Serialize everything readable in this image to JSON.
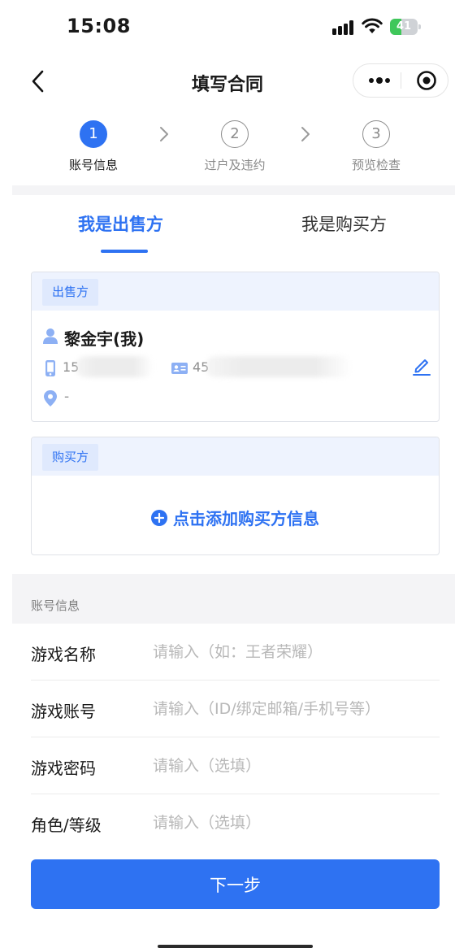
{
  "status_bar": {
    "time": "15:08",
    "battery": "41",
    "battery_level": 0.41
  },
  "nav": {
    "title": "填写合同"
  },
  "steps": [
    {
      "number": "1",
      "label": "账号信息",
      "active": true
    },
    {
      "number": "2",
      "label": "过户及违约",
      "active": false
    },
    {
      "number": "3",
      "label": "预览检查",
      "active": false
    }
  ],
  "role_tabs": {
    "seller": "我是出售方",
    "buyer": "我是购买方",
    "active": "seller"
  },
  "seller_card": {
    "tag": "出售方",
    "name": "黎金宇(我)",
    "phone": "15",
    "id_number": "45",
    "address": "-"
  },
  "buyer_card": {
    "tag": "购买方",
    "add_label": "点击添加购买方信息"
  },
  "account_info": {
    "section_title": "账号信息",
    "fields": [
      {
        "label": "游戏名称",
        "placeholder": "请输入（如：王者荣耀）"
      },
      {
        "label": "游戏账号",
        "placeholder": "请输入（ID/绑定邮箱/手机号等）"
      },
      {
        "label": "游戏密码",
        "placeholder": "请输入（选填）"
      },
      {
        "label": "角色/等级",
        "placeholder": "请输入（选填）"
      }
    ]
  },
  "next_button": {
    "label": "下一步"
  },
  "colors": {
    "primary": "#2e72f2",
    "tag_bg": "#dfe9fd",
    "section_bg": "#f4f4f6",
    "battery": "#3fc75a"
  }
}
